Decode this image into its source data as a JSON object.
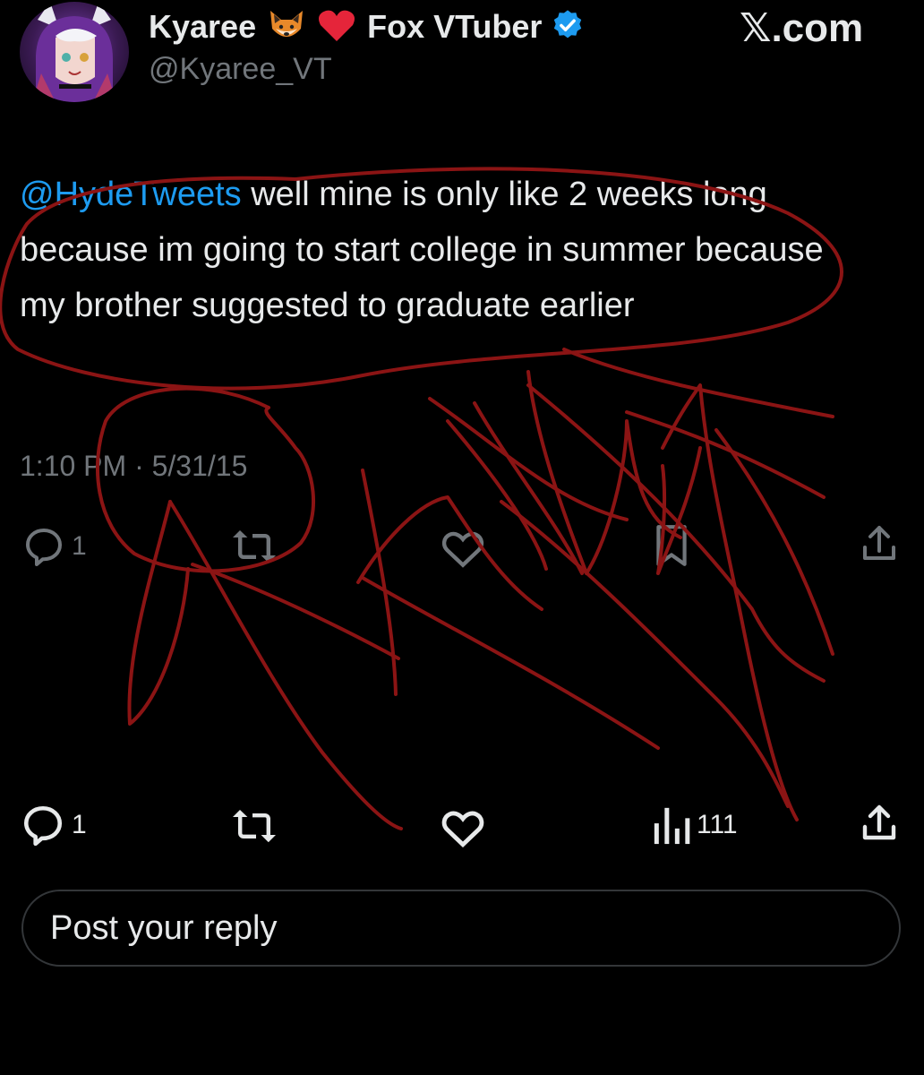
{
  "author": {
    "display_name": "Kyaree",
    "name_suffix": "Fox VTuber",
    "handle": "@Kyaree_VT",
    "emoji_icons": [
      "fox-face-icon",
      "red-heart-icon"
    ],
    "verified": true
  },
  "site": {
    "logo_text": "𝕏.com"
  },
  "tweet": {
    "mention": "@HydeTweets",
    "body": " well mine is only like 2 weeks long because im going to start college in summer because my brother suggested to graduate earlier",
    "timestamp": "1:10 PM · 5/31/15"
  },
  "actions_faded": {
    "reply_count": "1"
  },
  "actions": {
    "reply_count": "1",
    "views_count": "111"
  },
  "reply": {
    "placeholder": "Post your reply"
  },
  "colors": {
    "background": "#000000",
    "text": "#e7e9ea",
    "muted": "#71767b",
    "link": "#1d9bf0",
    "scribble": "#8b1414"
  },
  "icons": [
    "reply-icon",
    "retweet-icon",
    "like-icon",
    "bookmark-icon",
    "share-icon",
    "views-icon",
    "verified-badge-icon"
  ]
}
